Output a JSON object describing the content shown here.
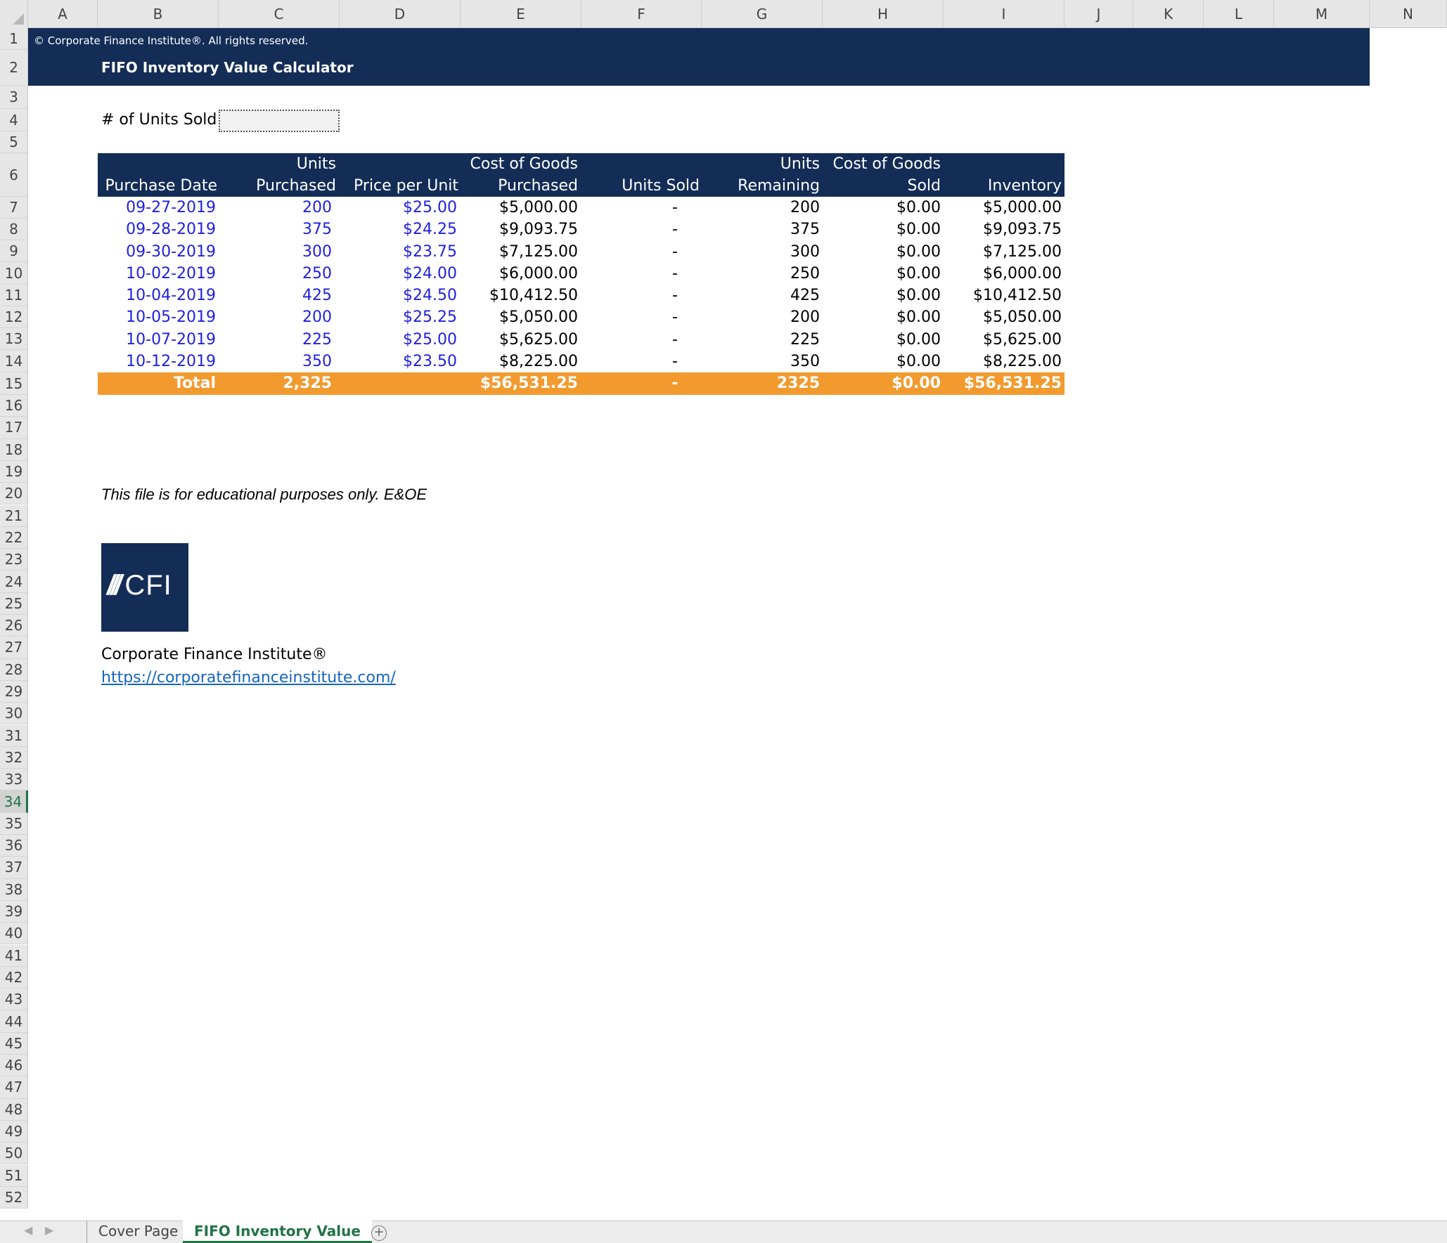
{
  "columns": [
    "A",
    "B",
    "C",
    "D",
    "E",
    "F",
    "G",
    "H",
    "I",
    "J",
    "K",
    "L",
    "M",
    "N"
  ],
  "rows": [
    1,
    2,
    3,
    4,
    5,
    6,
    7,
    8,
    9,
    10,
    11,
    12,
    13,
    14,
    15,
    16,
    17,
    18,
    19,
    20,
    21,
    22,
    23,
    24,
    25,
    26,
    27,
    28,
    29,
    30,
    31,
    32,
    33,
    34,
    35,
    36,
    37,
    38,
    39,
    40,
    41,
    42,
    43,
    44,
    45,
    46,
    47,
    48,
    49,
    50,
    51,
    52
  ],
  "selected_row": 34,
  "banner": {
    "copyright": "© Corporate Finance Institute®. All rights reserved.",
    "title": "FIFO Inventory Value Calculator"
  },
  "units_sold": {
    "label": "# of Units Sold",
    "value": ""
  },
  "table": {
    "headers": [
      "Purchase Date",
      "Units\nPurchased",
      "Price per Unit",
      "Cost of Goods\nPurchased",
      "Units Sold",
      "Units\nRemaining",
      "Cost of Goods\nSold",
      "Inventory Value"
    ],
    "rows": [
      {
        "date": "09-27-2019",
        "units": "200",
        "price": "$25.00",
        "cogp": "$5,000.00",
        "sold": "-",
        "remaining": "200",
        "cogs": "$0.00",
        "value": "$5,000.00"
      },
      {
        "date": "09-28-2019",
        "units": "375",
        "price": "$24.25",
        "cogp": "$9,093.75",
        "sold": "-",
        "remaining": "375",
        "cogs": "$0.00",
        "value": "$9,093.75"
      },
      {
        "date": "09-30-2019",
        "units": "300",
        "price": "$23.75",
        "cogp": "$7,125.00",
        "sold": "-",
        "remaining": "300",
        "cogs": "$0.00",
        "value": "$7,125.00"
      },
      {
        "date": "10-02-2019",
        "units": "250",
        "price": "$24.00",
        "cogp": "$6,000.00",
        "sold": "-",
        "remaining": "250",
        "cogs": "$0.00",
        "value": "$6,000.00"
      },
      {
        "date": "10-04-2019",
        "units": "425",
        "price": "$24.50",
        "cogp": "$10,412.50",
        "sold": "-",
        "remaining": "425",
        "cogs": "$0.00",
        "value": "$10,412.50"
      },
      {
        "date": "10-05-2019",
        "units": "200",
        "price": "$25.25",
        "cogp": "$5,050.00",
        "sold": "-",
        "remaining": "200",
        "cogs": "$0.00",
        "value": "$5,050.00"
      },
      {
        "date": "10-07-2019",
        "units": "225",
        "price": "$25.00",
        "cogp": "$5,625.00",
        "sold": "-",
        "remaining": "225",
        "cogs": "$0.00",
        "value": "$5,625.00"
      },
      {
        "date": "10-12-2019",
        "units": "350",
        "price": "$23.50",
        "cogp": "$8,225.00",
        "sold": "-",
        "remaining": "350",
        "cogs": "$0.00",
        "value": "$8,225.00"
      }
    ],
    "total": {
      "label": "Total",
      "units": "2,325",
      "cogp": "$56,531.25",
      "sold": "-",
      "remaining": "2325",
      "cogs": "$0.00",
      "value": "$56,531.25"
    }
  },
  "disclaimer": "This file is for educational purposes only. E&OE",
  "logo": {
    "mark": "///",
    "text": "CFI"
  },
  "org": {
    "name": "Corporate Finance Institute®",
    "url": "https://corporatefinanceinstitute.com/"
  },
  "sheets": {
    "tabs": [
      "Cover Page",
      "FIFO Inventory Value"
    ],
    "active": "FIFO Inventory Value"
  },
  "colors": {
    "navy": "#142d57",
    "orange": "#f29a2e",
    "input_blue": "#1f1fe0",
    "excel_green": "#217346"
  }
}
